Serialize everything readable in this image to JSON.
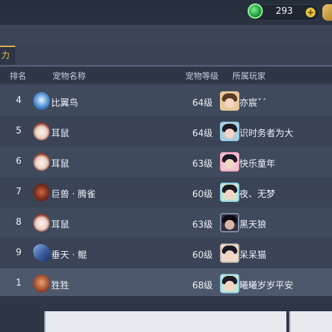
{
  "currency": {
    "value": "293",
    "plus_label": "+"
  },
  "tab": {
    "active_label": "力"
  },
  "table": {
    "headers": {
      "rank": "排名",
      "pet_name": "宠物名称",
      "pet_level": "宠物等级",
      "owner": "所属玩家"
    },
    "rows": [
      {
        "rank": "4",
        "pet": "比翼鸟",
        "level": "64级",
        "player": "亦宸ˇˊ"
      },
      {
        "rank": "5",
        "pet": "耳鼠",
        "level": "64级",
        "player": "识时务者为大"
      },
      {
        "rank": "6",
        "pet": "耳鼠",
        "level": "63级",
        "player": "快乐童年"
      },
      {
        "rank": "7",
        "pet": "巨兽 · 腾雀",
        "level": "60级",
        "player": "夜、无梦"
      },
      {
        "rank": "8",
        "pet": "耳鼠",
        "level": "63级",
        "player": "黑天狼"
      },
      {
        "rank": "9",
        "pet": "垂天 · 鲲",
        "level": "60级",
        "player": "呆呆猫"
      }
    ],
    "self_row": {
      "rank": "1",
      "pet": "狌狌",
      "level": "68级",
      "player": "曦曦岁岁平安"
    }
  }
}
